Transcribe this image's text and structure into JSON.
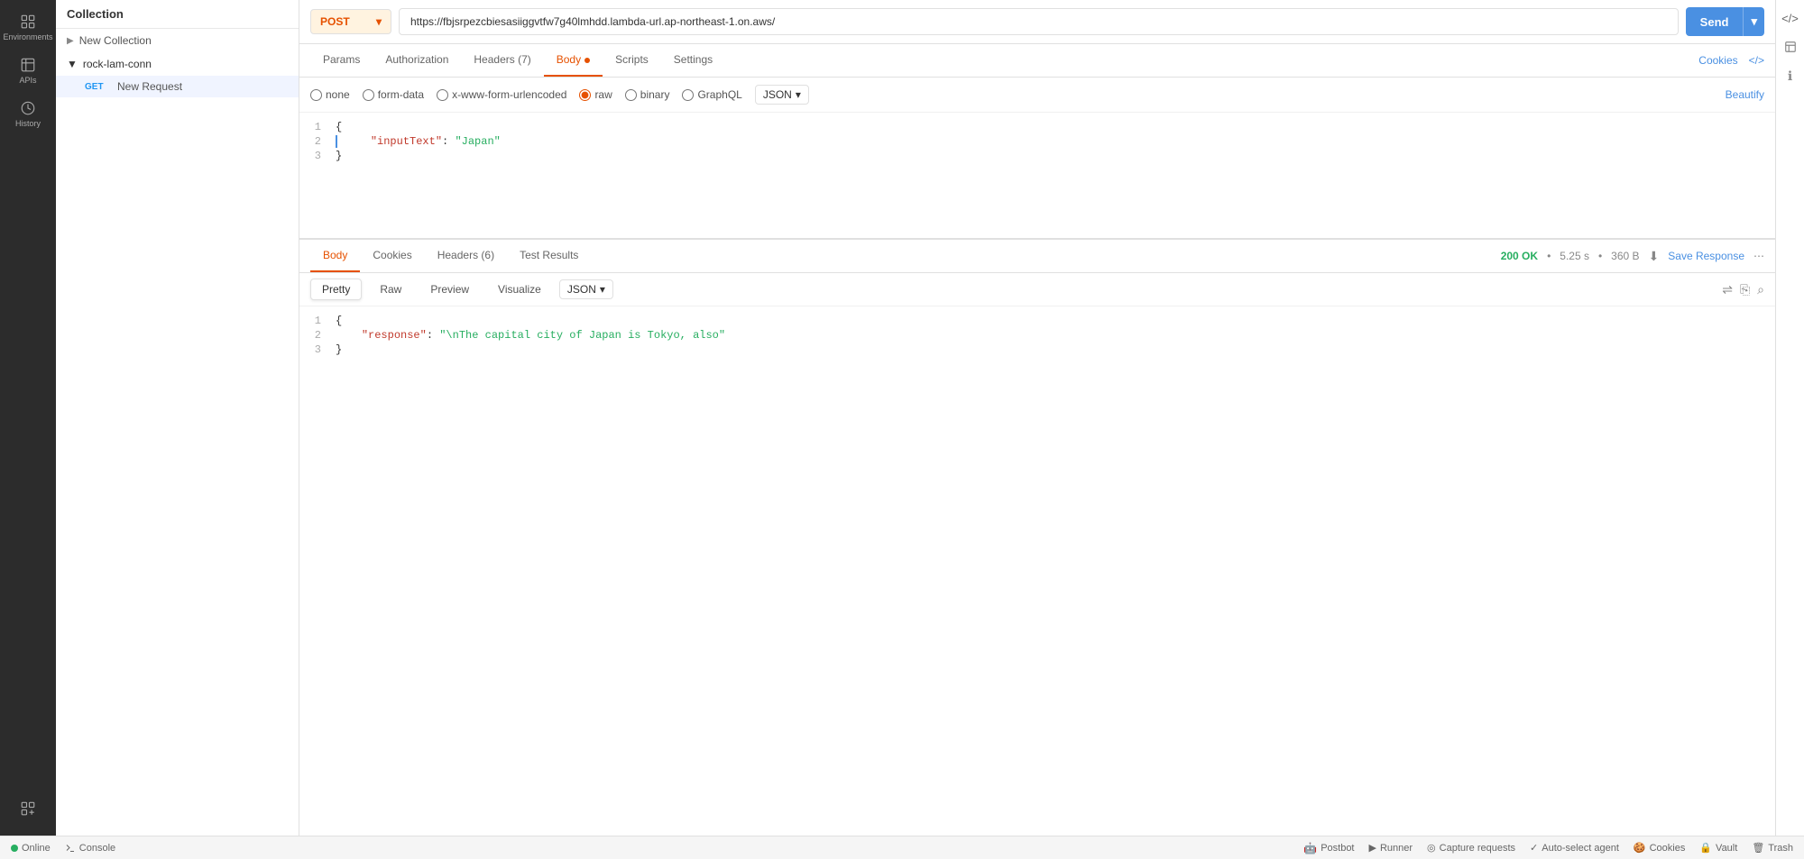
{
  "header": {
    "collection_label": "Collection"
  },
  "sidebar": {
    "icons": [
      {
        "name": "environments-icon",
        "label": "Environments",
        "symbol": "⊞"
      },
      {
        "name": "apis-icon",
        "label": "APIs",
        "symbol": "⌥"
      },
      {
        "name": "history-icon",
        "label": "History",
        "symbol": "⏱"
      },
      {
        "name": "collections-icon",
        "label": "",
        "symbol": "⊞+"
      }
    ]
  },
  "collections": {
    "header": "Collection",
    "items": [
      {
        "type": "new-collection",
        "label": "New Collection",
        "indent": false
      },
      {
        "type": "group",
        "label": "rock-lam-conn",
        "expanded": true
      },
      {
        "type": "request",
        "method": "GET",
        "label": "New Request"
      }
    ]
  },
  "request": {
    "method": "POST",
    "url": "https://fbjsrpezcbiesasiiggvtfw7g40lmhdd.lambda-url.ap-northeast-1.on.aws/",
    "tabs": [
      {
        "id": "params",
        "label": "Params",
        "active": false
      },
      {
        "id": "authorization",
        "label": "Authorization",
        "active": false
      },
      {
        "id": "headers",
        "label": "Headers (7)",
        "active": false
      },
      {
        "id": "body",
        "label": "Body",
        "active": true,
        "has_dot": true
      },
      {
        "id": "scripts",
        "label": "Scripts",
        "active": false
      },
      {
        "id": "settings",
        "label": "Settings",
        "active": false
      }
    ],
    "cookies_link": "Cookies",
    "code_link": "</>",
    "send_label": "Send",
    "body_options": {
      "none": "none",
      "form_data": "form-data",
      "urlencoded": "x-www-form-urlencoded",
      "raw": "raw",
      "binary": "binary",
      "graphql": "GraphQL"
    },
    "format": "JSON",
    "beautify_label": "Beautify",
    "body_code": [
      {
        "line": 1,
        "content": "{",
        "type": "bracket"
      },
      {
        "line": 2,
        "content": "    \"inputText\": \"Japan\"",
        "type": "kv",
        "has_bar": true
      },
      {
        "line": 3,
        "content": "}",
        "type": "bracket"
      }
    ]
  },
  "response": {
    "tabs": [
      {
        "id": "body",
        "label": "Body",
        "active": true
      },
      {
        "id": "cookies",
        "label": "Cookies",
        "active": false
      },
      {
        "id": "headers",
        "label": "Headers (6)",
        "active": false
      },
      {
        "id": "test_results",
        "label": "Test Results",
        "active": false
      }
    ],
    "status": "200 OK",
    "time": "5.25 s",
    "size": "360 B",
    "save_response_label": "Save Response",
    "format_buttons": [
      {
        "id": "pretty",
        "label": "Pretty",
        "active": true
      },
      {
        "id": "raw",
        "label": "Raw",
        "active": false
      },
      {
        "id": "preview",
        "label": "Preview",
        "active": false
      },
      {
        "id": "visualize",
        "label": "Visualize",
        "active": false
      }
    ],
    "format": "JSON",
    "code_lines": [
      {
        "line": 1,
        "content": "{",
        "type": "bracket"
      },
      {
        "line": 2,
        "content": "    \"response\": \"\\nThe capital city of Japan is Tokyo, also\"",
        "type": "kv"
      },
      {
        "line": 3,
        "content": "}",
        "type": "bracket"
      }
    ]
  },
  "status_bar": {
    "online_label": "Online",
    "console_label": "Console",
    "postbot_label": "Postbot",
    "runner_label": "Runner",
    "capture_label": "Capture requests",
    "auto_select_label": "Auto-select agent",
    "cookies_label": "Cookies",
    "vault_label": "Vault",
    "trash_label": "Trash"
  }
}
